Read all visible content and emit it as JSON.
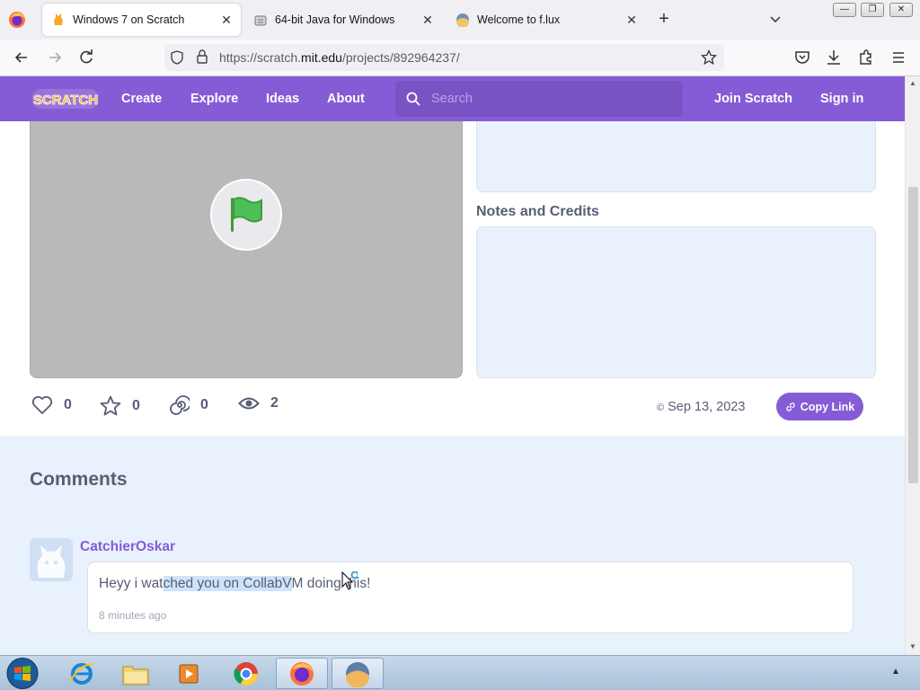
{
  "browser": {
    "tabs": [
      {
        "title": "Windows 7 on Scratch",
        "favicon": "scratch-cat-icon",
        "active": true
      },
      {
        "title": "64-bit Java for Windows",
        "favicon": "java-icon",
        "active": false
      },
      {
        "title": "Welcome to f.lux",
        "favicon": "flux-icon",
        "active": false
      }
    ],
    "close_glyph": "✕",
    "new_tab_glyph": "+",
    "url_prefix": "https://scratch.",
    "url_domain": "mit.edu",
    "url_path": "/projects/892964237/",
    "window_controls": [
      "—",
      "❐",
      "✕"
    ]
  },
  "scratch": {
    "logo_text": "SCRATCH",
    "nav": [
      "Create",
      "Explore",
      "Ideas",
      "About"
    ],
    "search_placeholder": "Search",
    "join": "Join Scratch",
    "signin": "Sign in"
  },
  "project": {
    "notes_title": "Notes and Credits",
    "stats": {
      "loves": "0",
      "favorites": "0",
      "remixes": "0",
      "views": "2"
    },
    "date": "Sep 13, 2023",
    "copy_link": "Copy Link"
  },
  "comments": {
    "title": "Comments",
    "items": [
      {
        "author": "CatchierOskar",
        "text_before": "Heyy i wat",
        "text_highlight": "ched you on CollabV",
        "text_after": "M doing this!",
        "time": "8 minutes ago"
      }
    ]
  },
  "colors": {
    "scratch_purple": "#855cd6",
    "comment_bg": "#e9f1fc",
    "stage_gray": "#b9b9b9"
  }
}
